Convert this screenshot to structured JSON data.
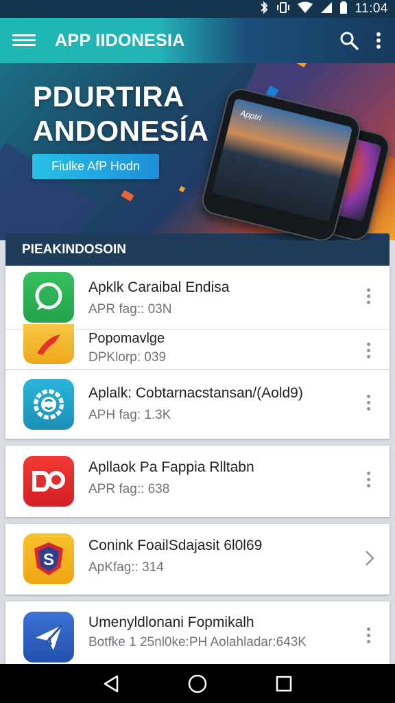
{
  "status_bar": {
    "time": "11:04",
    "icons": [
      "bluetooth-icon",
      "vibrate-icon",
      "wifi-icon",
      "signal-icon",
      "battery-icon"
    ]
  },
  "app_bar": {
    "title": "APP IIDONESIA",
    "icons": [
      "menu-icon",
      "search-icon",
      "more-vert-icon"
    ],
    "colors": {
      "start": "#1fb7b1",
      "end": "#173a5c"
    }
  },
  "hero": {
    "title_line1": "PDURTIRA",
    "title_line2": "ANDONESÍA",
    "button_label": "Fiulke AfP Hodn",
    "phone_screen_text": "Apptri"
  },
  "section": {
    "title": "PIEAKINDOSOIN"
  },
  "apps": [
    {
      "name": "Apklk Caraibal Endisa",
      "meta": "APR fag:: 03N",
      "icon": "chat-bubble-icon",
      "color": "#2fb457",
      "action": "more-vert-icon"
    },
    {
      "name": "Popomavlge",
      "meta": "DPKlorp: 039",
      "icon": "red-arrow-icon",
      "color": "#f2b72c",
      "action": "more-vert-icon"
    },
    {
      "name": "Aplalk: Cobtarnacstansan/(Aold9)",
      "meta": "APH fag: 1.3K",
      "icon": "gear-s-icon",
      "color": "#1ea1c9",
      "action": "more-vert-icon"
    },
    {
      "name": "Apllaok Pa Fappia Rlltabn",
      "meta": "APR fag:: 638",
      "icon": "do-logo-icon",
      "color": "#e32a2a",
      "action": "more-vert-icon"
    },
    {
      "name": "Conink FoailSdajasit 6l0l69",
      "meta": "ApKfag:: 314",
      "icon": "s-shield-icon",
      "color": "#f5b51e",
      "action": "chevron-right-icon"
    },
    {
      "name": "Umenyldlonani Fopmikalh",
      "meta": "Botfke 1 25nl0ke:PH Aolahladar:643K",
      "icon": "paper-plane-icon",
      "color": "#2f63c4",
      "action": "more-vert-icon"
    }
  ],
  "nav_bar": {
    "icons": [
      "back-icon",
      "home-icon",
      "recents-icon"
    ]
  }
}
